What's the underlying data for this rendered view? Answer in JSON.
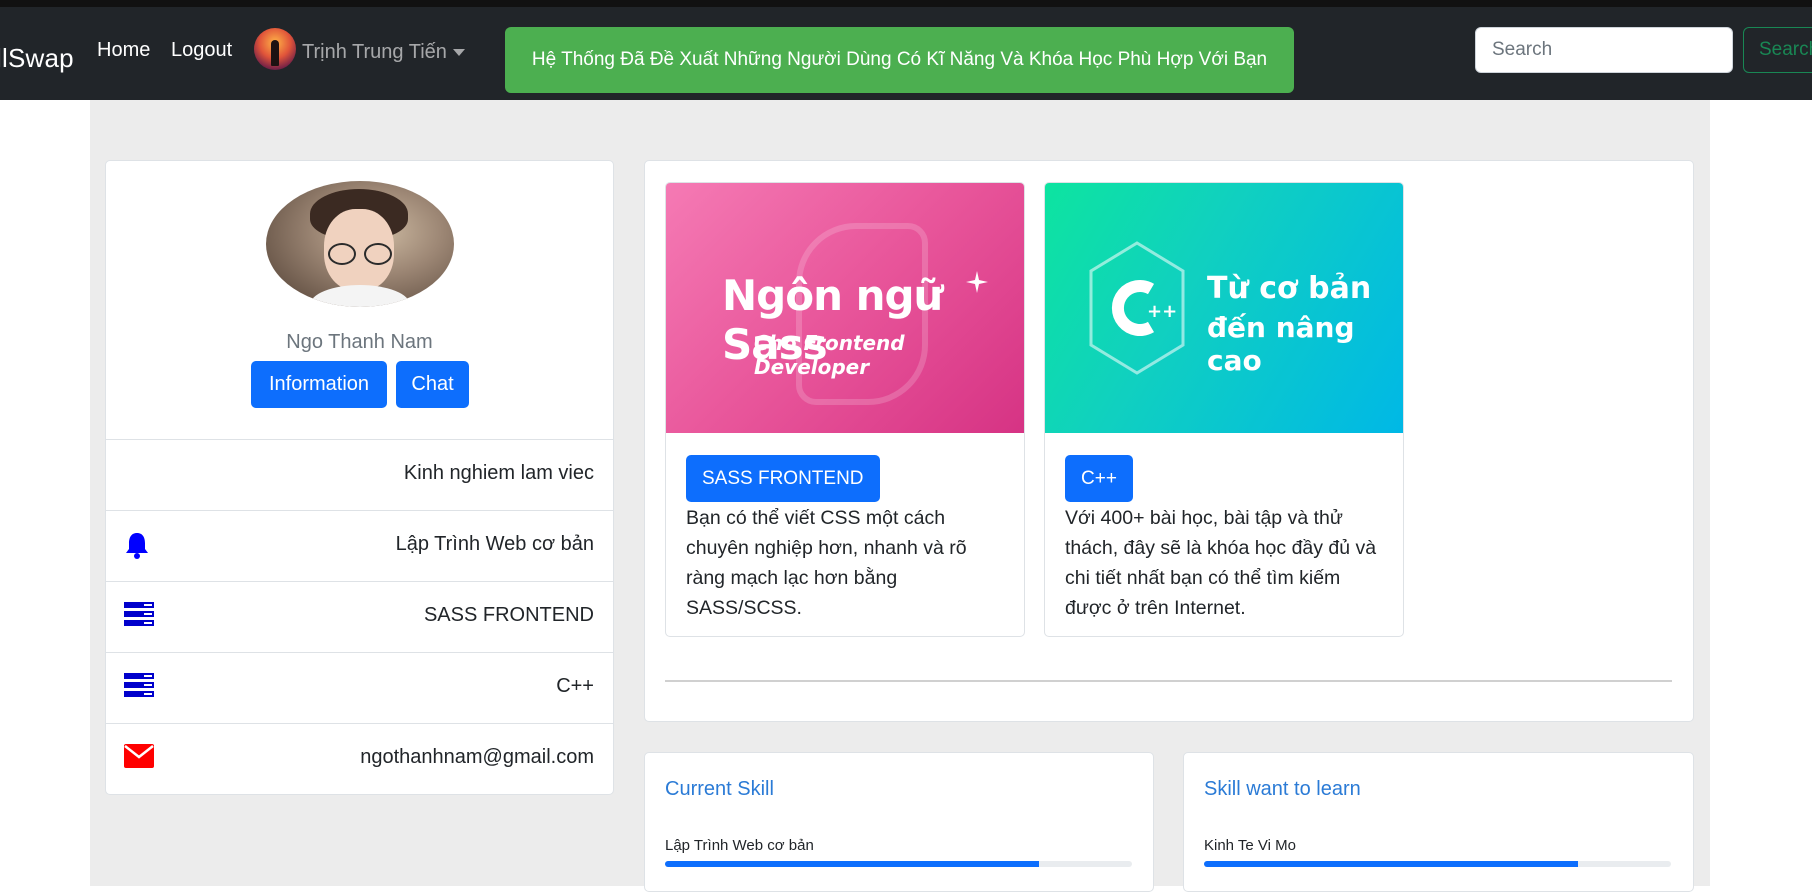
{
  "navbar": {
    "brand": "llSwap",
    "home": "Home",
    "logout": "Logout",
    "user_name": "Trịnh Trung Tiến",
    "alert": "Hệ Thống Đã Đề Xuất Những Người Dùng Có Kĩ Năng Và Khóa Học Phù Hợp Với Bạn",
    "search_placeholder": "Search",
    "search_button": "Search"
  },
  "profile": {
    "name": "Ngo Thanh Nam",
    "information_button": "Information",
    "chat_button": "Chat",
    "items": [
      {
        "icon": "",
        "text": "Kinh nghiem lam viec"
      },
      {
        "icon": "bell-icon",
        "text": "Lập Trình Web cơ bản"
      },
      {
        "icon": "server-icon",
        "text": "SASS FRONTEND"
      },
      {
        "icon": "server-icon",
        "text": "C++"
      },
      {
        "icon": "envelope-icon",
        "text": "ngothanhnam@gmail.com"
      }
    ],
    "colors": {
      "bell": "#0000ff",
      "server": "#0000cc",
      "envelope": "#ff0000"
    }
  },
  "courses": [
    {
      "thumb_title": "Ngôn ngữ Sass",
      "thumb_subtitle": "Cho Frontend Developer",
      "tag": "SASS FRONTEND",
      "description": "Bạn có thể viết CSS một cách chuyên nghiệp hơn, nhanh và rõ ràng mạch lạc hơn bằng SASS/SCSS."
    },
    {
      "thumb_title": "Từ cơ bản",
      "thumb_subtitle": "đến nâng cao",
      "tag": "C++",
      "description": "Với 400+ bài học, bài tập và thử thách, đây sẽ là khóa học đầy đủ và chi tiết nhất bạn có thể tìm kiếm được ở trên Internet."
    }
  ],
  "skills": {
    "current": {
      "title": "Current Skill",
      "label": "Lập Trình Web cơ bản",
      "progress": 0.8
    },
    "want": {
      "title": "Skill want to learn",
      "label": "Kinh Te Vi Mo",
      "progress": 0.8
    }
  },
  "colors": {
    "primary": "#0d6efd",
    "navbar": "#212529",
    "alert": "#4caf50",
    "search_outline": "#198754"
  }
}
